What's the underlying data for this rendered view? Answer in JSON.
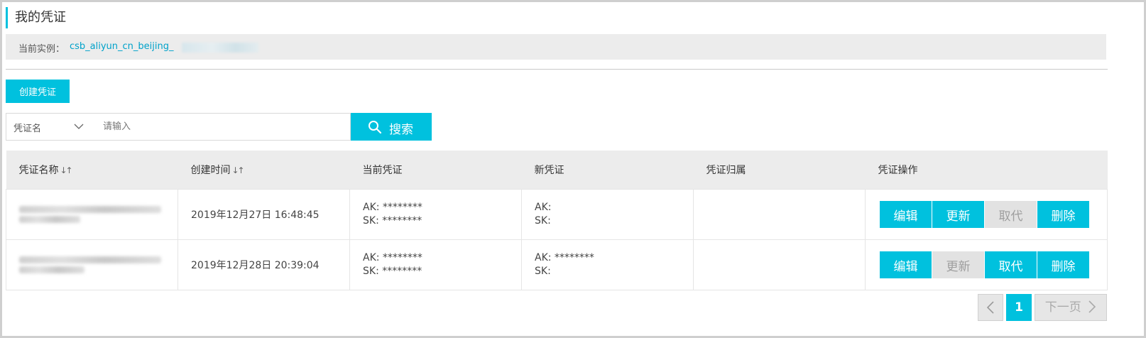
{
  "page": {
    "title": "我的凭证"
  },
  "instance": {
    "label": "当前实例：",
    "value": "csb_aliyun_cn_beijing_"
  },
  "toolbar": {
    "create_label": "创建凭证"
  },
  "search": {
    "select_value": "凭证名",
    "placeholder": "请输入",
    "button_label": "搜索"
  },
  "table": {
    "headers": [
      "凭证名称",
      "创建时间",
      "当前凭证",
      "新凭证",
      "凭证归属",
      "凭证操作"
    ],
    "rows": [
      {
        "created": "2019年12月27日 16:48:45",
        "current_ak": "AK: ********",
        "current_sk": "SK: ********",
        "new_ak": "AK:",
        "new_sk": "SK:",
        "owner": "",
        "ops": [
          {
            "label": "编辑",
            "enabled": true
          },
          {
            "label": "更新",
            "enabled": true
          },
          {
            "label": "取代",
            "enabled": false
          },
          {
            "label": "删除",
            "enabled": true
          }
        ]
      },
      {
        "created": "2019年12月28日 20:39:04",
        "current_ak": "AK: ********",
        "current_sk": "SK: ********",
        "new_ak": "AK: ********",
        "new_sk": "SK:",
        "owner": "",
        "ops": [
          {
            "label": "编辑",
            "enabled": true
          },
          {
            "label": "更新",
            "enabled": false
          },
          {
            "label": "取代",
            "enabled": true
          },
          {
            "label": "删除",
            "enabled": true
          }
        ]
      }
    ]
  },
  "pagination": {
    "current": "1",
    "next_label": "下一页"
  },
  "colors": {
    "accent": "#00c1de",
    "disabled_bg": "#e2e2e2",
    "header_bg": "#ececec"
  }
}
